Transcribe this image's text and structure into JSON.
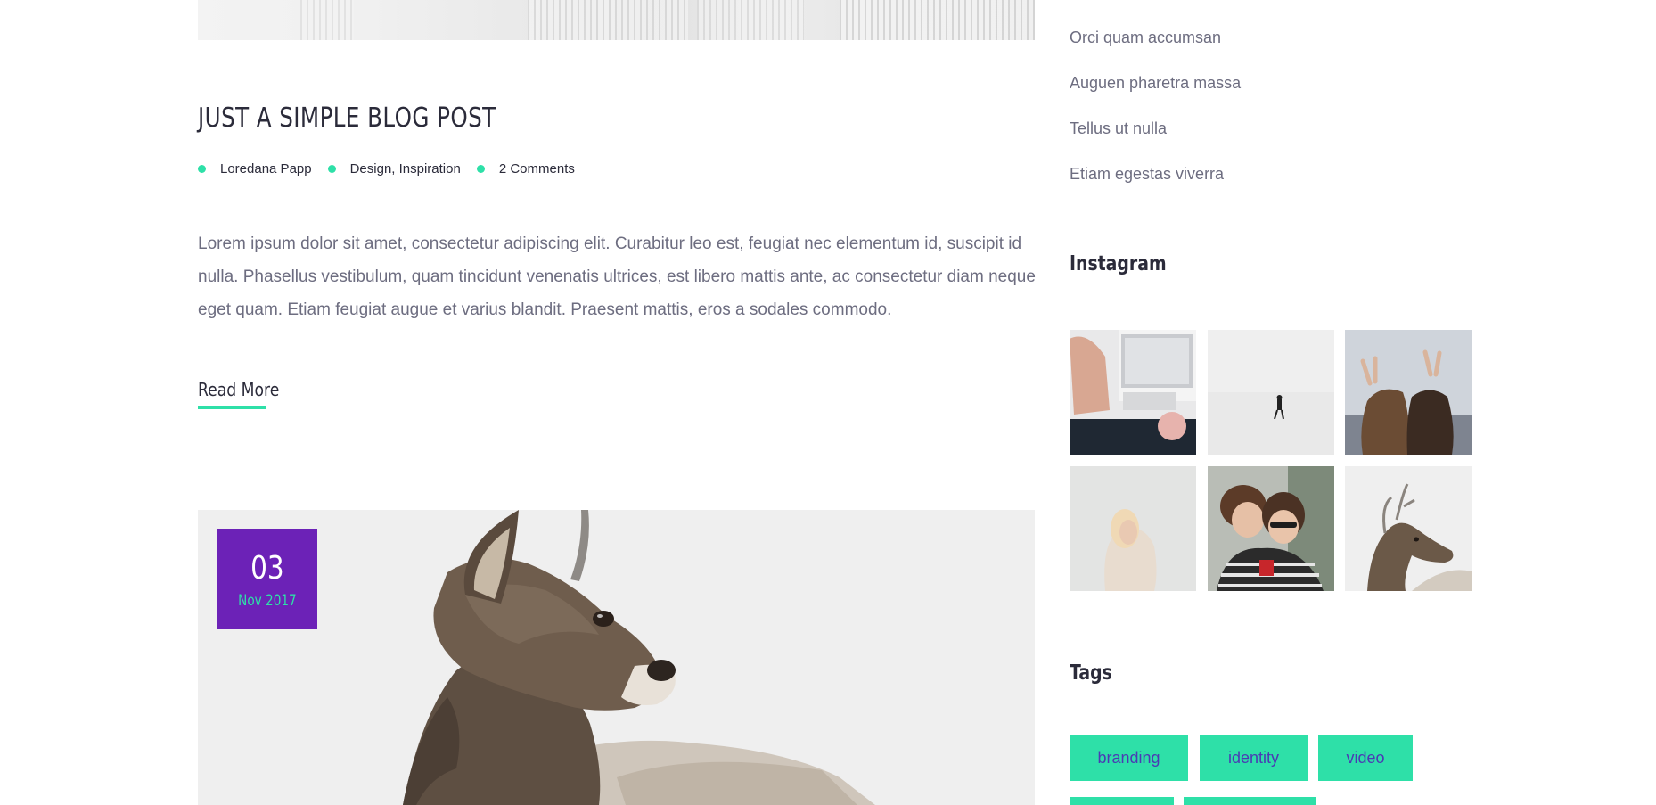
{
  "post": {
    "title": "JUST A SIMPLE BLOG POST",
    "author": "Loredana Papp",
    "categories": "Design, Inspiration",
    "comments": "2 Comments",
    "excerpt": "Lorem ipsum dolor sit amet, consectetur adipiscing elit. Curabitur leo est, feugiat nec elementum id, suscipit id nulla. Phasellus vestibulum, quam tincidunt venenatis ultrices, est libero mattis ante, ac consectetur diam neque eget quam. Etiam feugiat augue et varius blandit. Praesent mattis, eros a sodales commodo.",
    "read_more": "Read More"
  },
  "next_post": {
    "date_day": "03",
    "date_month": "Nov 2017"
  },
  "sidebar": {
    "list_items": [
      "Orci quam accumsan",
      "Auguen pharetra massa",
      "Tellus ut nulla",
      "Etiam egestas viverra"
    ],
    "instagram_title": "Instagram",
    "tags_title": "Tags",
    "tags": [
      "branding",
      "identity",
      "video"
    ]
  },
  "colors": {
    "accent": "#2ee0a8",
    "brand_purple": "#6c22b7",
    "heading": "#2b2b3a",
    "body_text": "#6d6d80"
  }
}
